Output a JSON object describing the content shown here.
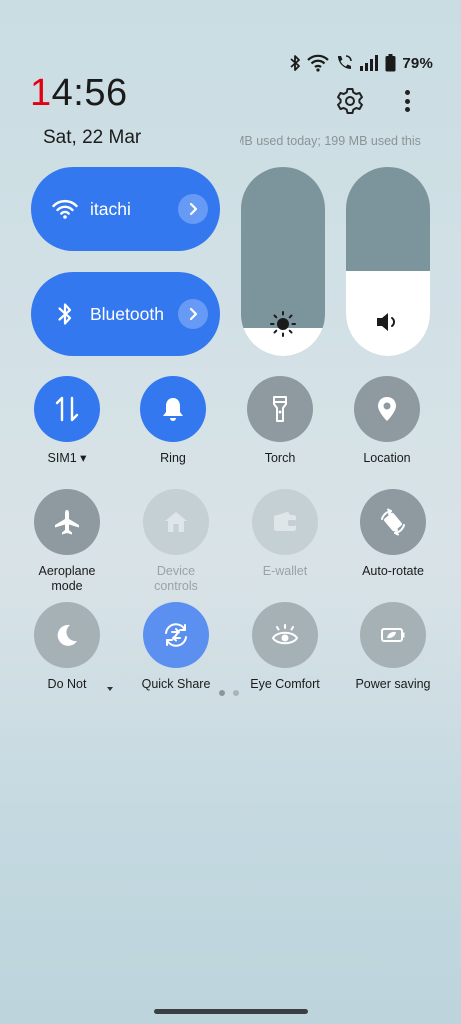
{
  "status_bar": {
    "battery_percent": "79%"
  },
  "clock": {
    "hour_first": "1",
    "rest": "4:56"
  },
  "date": "Sat, 22 Mar",
  "data_usage": "MB used today; 199 MB used this",
  "pills": {
    "wifi": {
      "label": "itachi"
    },
    "bluetooth": {
      "label": "Bluetooth"
    }
  },
  "sliders": {
    "brightness_level": 0.15,
    "volume_level": 0.45
  },
  "tiles_row1": [
    {
      "label": "SIM1 ▾",
      "icon": "data-transfer-icon"
    },
    {
      "label": "Ring",
      "icon": "bell-icon"
    },
    {
      "label": "Torch",
      "icon": "flashlight-icon"
    },
    {
      "label": "Location",
      "icon": "location-pin-icon"
    }
  ],
  "tiles_row2": [
    {
      "label": "Aeroplane mode",
      "icon": "airplane-icon"
    },
    {
      "label": "Device controls",
      "icon": "home-icon"
    },
    {
      "label": "E-wallet",
      "icon": "wallet-icon"
    },
    {
      "label": "Auto-rotate",
      "icon": "auto-rotate-icon"
    }
  ],
  "tiles_row3": [
    {
      "label": "Do Not",
      "icon": "moon-icon"
    },
    {
      "label": "Quick Share",
      "icon": "quick-share-icon"
    },
    {
      "label": "Eye Comfort",
      "icon": "eye-icon"
    },
    {
      "label": "Power saving",
      "icon": "battery-leaf-icon"
    }
  ],
  "colors": {
    "accent": "#3478f0",
    "clock_red": "#e3000f",
    "tile_gray": "#8e9aa0"
  }
}
